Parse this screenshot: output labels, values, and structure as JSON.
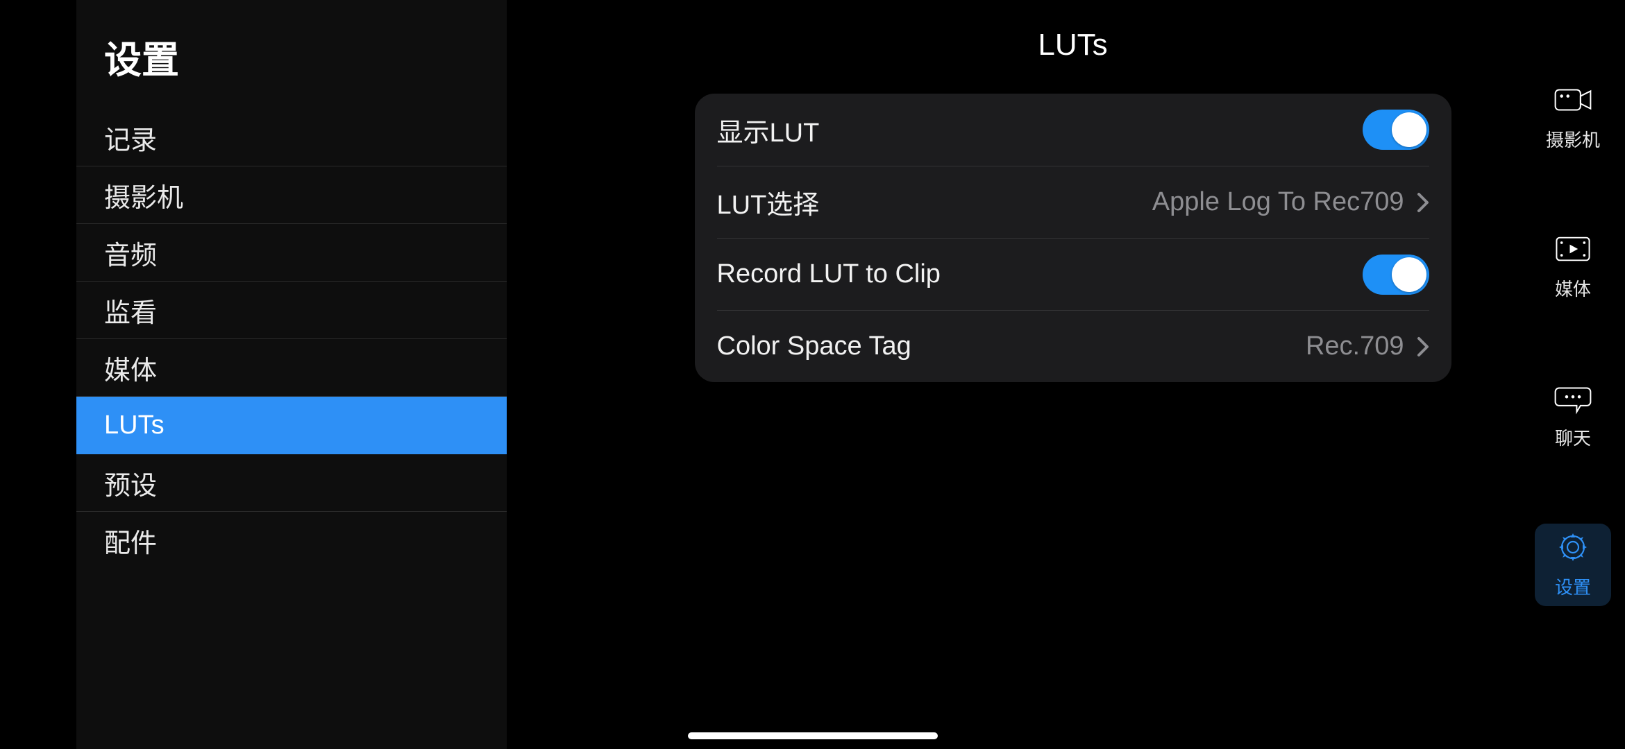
{
  "sidebar": {
    "title": "设置",
    "items": [
      {
        "label": "记录",
        "active": false
      },
      {
        "label": "摄影机",
        "active": false
      },
      {
        "label": "音频",
        "active": false
      },
      {
        "label": "监看",
        "active": false
      },
      {
        "label": "媒体",
        "active": false
      },
      {
        "label": "LUTs",
        "active": true
      },
      {
        "label": "预设",
        "active": false
      },
      {
        "label": "配件",
        "active": false
      }
    ]
  },
  "main": {
    "title": "LUTs",
    "rows": {
      "display_lut": {
        "label": "显示LUT",
        "type": "toggle",
        "on": true
      },
      "lut_select": {
        "label": "LUT选择",
        "type": "nav",
        "value": "Apple Log To Rec709"
      },
      "record_lut": {
        "label": "Record LUT to Clip",
        "type": "toggle",
        "on": true
      },
      "color_space_tag": {
        "label": "Color Space Tag",
        "type": "nav",
        "value": "Rec.709"
      }
    }
  },
  "rail": {
    "items": [
      {
        "label": "摄影机",
        "icon": "camera-icon",
        "active": false
      },
      {
        "label": "媒体",
        "icon": "media-icon",
        "active": false
      },
      {
        "label": "聊天",
        "icon": "chat-icon",
        "active": false
      },
      {
        "label": "设置",
        "icon": "gear-icon",
        "active": true
      }
    ]
  },
  "colors": {
    "accent": "#2e90f6",
    "card": "#1c1c1e",
    "muted": "#8e8e92"
  }
}
